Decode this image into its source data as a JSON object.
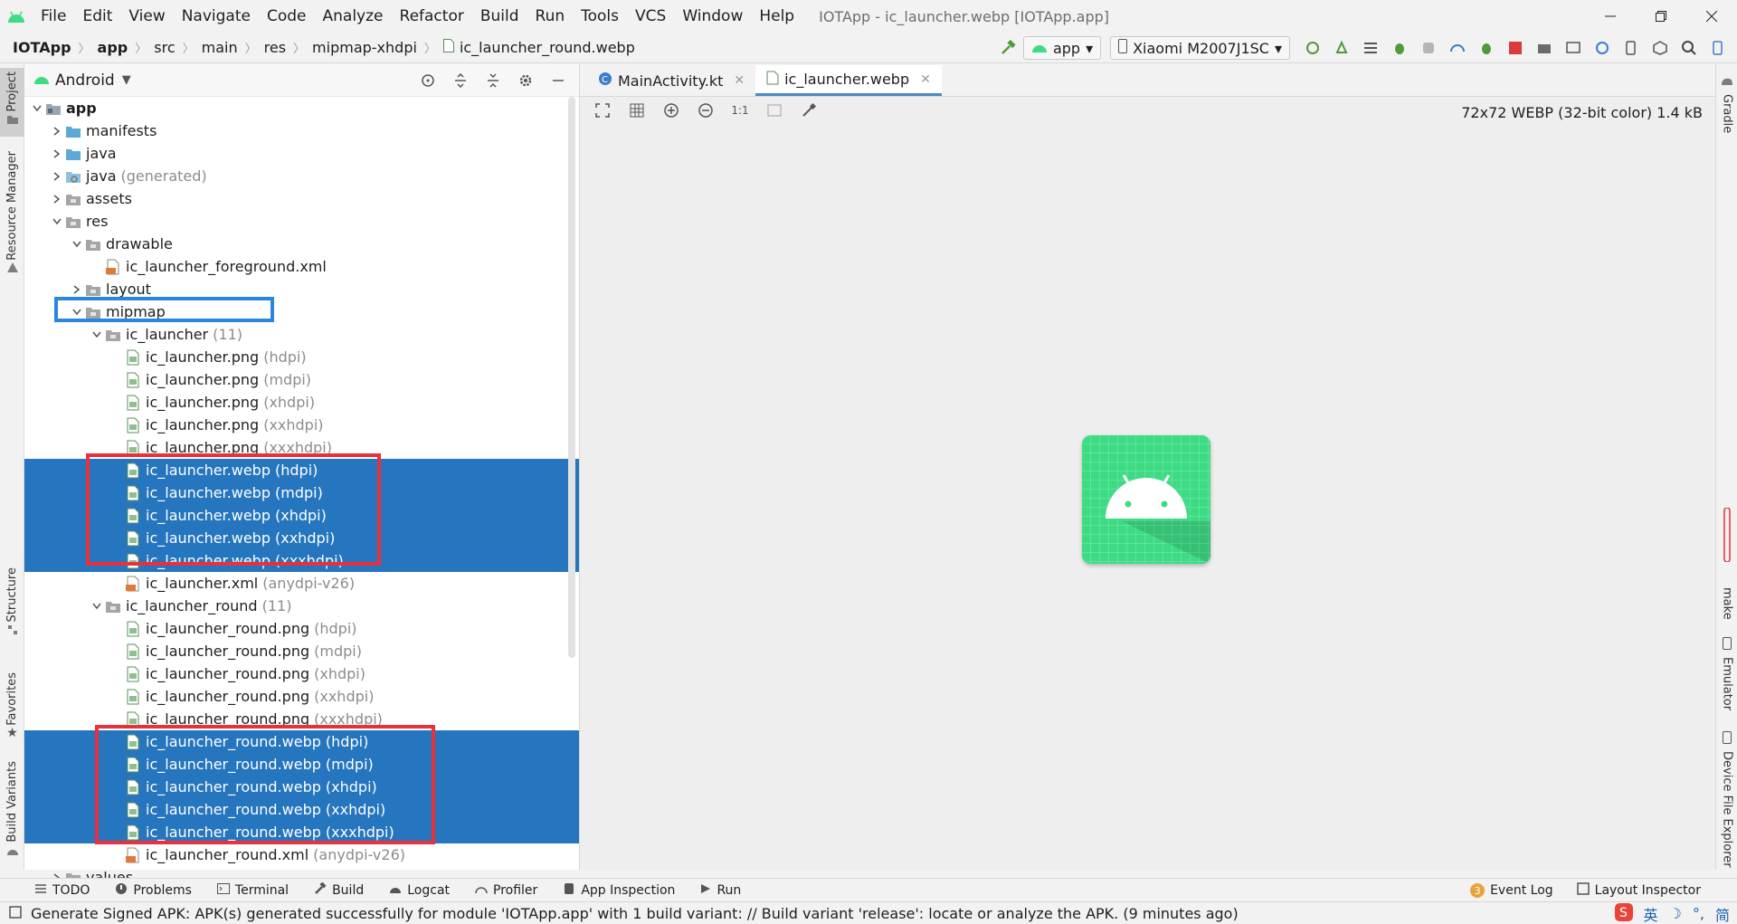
{
  "window": {
    "title": "IOTApp - ic_launcher.webp [IOTApp.app]",
    "menu": [
      "File",
      "Edit",
      "View",
      "Navigate",
      "Code",
      "Analyze",
      "Refactor",
      "Build",
      "Run",
      "Tools",
      "VCS",
      "Window",
      "Help"
    ]
  },
  "breadcrumb": [
    "IOTApp",
    "app",
    "src",
    "main",
    "res",
    "mipmap-xhdpi",
    "ic_launcher_round.webp"
  ],
  "run_config": {
    "module": "app",
    "device": "Xiaomi M2007J1SC"
  },
  "left_strip": {
    "project": "Project",
    "resource_manager": "Resource Manager",
    "structure": "Structure",
    "favorites": "Favorites",
    "build_variants": "Build Variants"
  },
  "project_panel": {
    "view": "Android",
    "tree": [
      {
        "label": "app",
        "suffix": "",
        "type": "module",
        "arrow": "down",
        "bold": true
      },
      {
        "label": "manifests",
        "suffix": "",
        "type": "folder",
        "arrow": "right"
      },
      {
        "label": "java",
        "suffix": "",
        "type": "folder",
        "arrow": "right"
      },
      {
        "label": "java",
        "suffix": "(generated)",
        "type": "folder-gen",
        "arrow": "right"
      },
      {
        "label": "assets",
        "suffix": "",
        "type": "folder-grey",
        "arrow": "right"
      },
      {
        "label": "res",
        "suffix": "",
        "type": "folder-grey",
        "arrow": "down"
      },
      {
        "label": "drawable",
        "suffix": "",
        "type": "folder-grey",
        "arrow": "down"
      },
      {
        "label": "ic_launcher_foreground.xml",
        "suffix": "",
        "type": "xml",
        "arrow": ""
      },
      {
        "label": "layout",
        "suffix": "",
        "type": "folder-grey",
        "arrow": "right"
      },
      {
        "label": "mipmap",
        "suffix": "",
        "type": "folder-grey",
        "arrow": "down"
      },
      {
        "label": "ic_launcher",
        "suffix": "(11)",
        "type": "folder-grey",
        "arrow": "down"
      },
      {
        "label": "ic_launcher.png",
        "suffix": "(hdpi)",
        "type": "img",
        "arrow": ""
      },
      {
        "label": "ic_launcher.png",
        "suffix": "(mdpi)",
        "type": "img",
        "arrow": ""
      },
      {
        "label": "ic_launcher.png",
        "suffix": "(xhdpi)",
        "type": "img",
        "arrow": ""
      },
      {
        "label": "ic_launcher.png",
        "suffix": "(xxhdpi)",
        "type": "img",
        "arrow": ""
      },
      {
        "label": "ic_launcher.png",
        "suffix": "(xxxhdpi)",
        "type": "img",
        "arrow": ""
      },
      {
        "label": "ic_launcher.webp",
        "suffix": "(hdpi)",
        "type": "img",
        "arrow": "",
        "selected": true
      },
      {
        "label": "ic_launcher.webp",
        "suffix": "(mdpi)",
        "type": "img",
        "arrow": "",
        "selected": true
      },
      {
        "label": "ic_launcher.webp",
        "suffix": "(xhdpi)",
        "type": "img",
        "arrow": "",
        "selected": true
      },
      {
        "label": "ic_launcher.webp",
        "suffix": "(xxhdpi)",
        "type": "img",
        "arrow": "",
        "selected": true
      },
      {
        "label": "ic_launcher.webp",
        "suffix": "(xxxhdpi)",
        "type": "img",
        "arrow": "",
        "selected": true
      },
      {
        "label": "ic_launcher.xml",
        "suffix": "(anydpi-v26)",
        "type": "xml",
        "arrow": ""
      },
      {
        "label": "ic_launcher_round",
        "suffix": "(11)",
        "type": "folder-grey",
        "arrow": "down"
      },
      {
        "label": "ic_launcher_round.png",
        "suffix": "(hdpi)",
        "type": "img",
        "arrow": ""
      },
      {
        "label": "ic_launcher_round.png",
        "suffix": "(mdpi)",
        "type": "img",
        "arrow": ""
      },
      {
        "label": "ic_launcher_round.png",
        "suffix": "(xhdpi)",
        "type": "img",
        "arrow": ""
      },
      {
        "label": "ic_launcher_round.png",
        "suffix": "(xxhdpi)",
        "type": "img",
        "arrow": ""
      },
      {
        "label": "ic_launcher_round.png",
        "suffix": "(xxxhdpi)",
        "type": "img",
        "arrow": ""
      },
      {
        "label": "ic_launcher_round.webp",
        "suffix": "(hdpi)",
        "type": "img",
        "arrow": "",
        "selected": true
      },
      {
        "label": "ic_launcher_round.webp",
        "suffix": "(mdpi)",
        "type": "img",
        "arrow": "",
        "selected": true
      },
      {
        "label": "ic_launcher_round.webp",
        "suffix": "(xhdpi)",
        "type": "img",
        "arrow": "",
        "selected": true
      },
      {
        "label": "ic_launcher_round.webp",
        "suffix": "(xxhdpi)",
        "type": "img",
        "arrow": "",
        "selected": true
      },
      {
        "label": "ic_launcher_round.webp",
        "suffix": "(xxxhdpi)",
        "type": "img",
        "arrow": "",
        "selected": true
      },
      {
        "label": "ic_launcher_round.xml",
        "suffix": "(anydpi-v26)",
        "type": "xml",
        "arrow": ""
      },
      {
        "label": "values",
        "suffix": "",
        "type": "folder-grey",
        "arrow": "right"
      }
    ]
  },
  "editor": {
    "tabs": [
      {
        "label": "MainActivity.kt",
        "icon": "kotlin-class-icon",
        "active": false
      },
      {
        "label": "ic_launcher.webp",
        "icon": "image-file-icon",
        "active": true
      }
    ],
    "zoom_label": "1:1",
    "image_info": "72x72 WEBP (32-bit color) 1.4 kB"
  },
  "right_strip": {
    "gradle": "Gradle",
    "make": "make",
    "emulator": "Emulator",
    "device_file_explorer": "Device File Explorer"
  },
  "bottom_tools": [
    "TODO",
    "Problems",
    "Terminal",
    "Build",
    "Logcat",
    "Profiler",
    "App Inspection",
    "Run"
  ],
  "bottom_right": {
    "event_log": "Event Log",
    "event_count": "3",
    "layout_inspector": "Layout Inspector"
  },
  "status": {
    "message": "Generate Signed APK: APK(s) generated successfully for module 'IOTApp.app' with 1 build variant: // Build variant 'release': locate or analyze the APK. (9 minutes ago)"
  },
  "ime": {
    "lang": "英",
    "simplified": "简"
  },
  "colors": {
    "selection": "#2675bf",
    "highlight_red": "#e8313a",
    "highlight_blue": "#2b86de",
    "android_green": "#3ddc84"
  }
}
